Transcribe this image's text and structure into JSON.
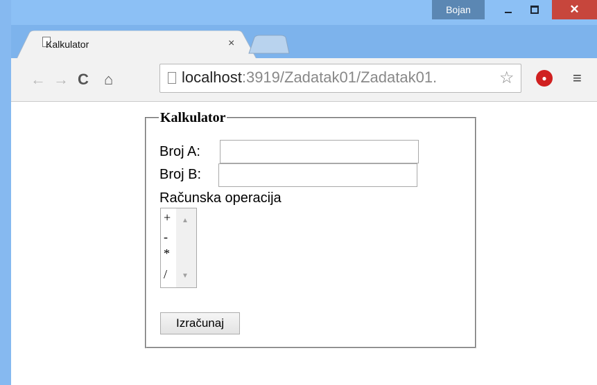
{
  "window": {
    "user": "Bojan",
    "minimize_glyph": "–",
    "maximize_glyph": "□",
    "close_glyph": "✕"
  },
  "tab": {
    "title": "Kalkulator",
    "close_glyph": "×"
  },
  "toolbar": {
    "back_glyph": "←",
    "forward_glyph": "→",
    "reload_glyph": "C",
    "home_glyph": "⌂",
    "url_host": "localhost",
    "url_path": ":3919/Zadatak01/Zadatak01.",
    "star_glyph": "☆",
    "menu_glyph": "≡"
  },
  "form": {
    "legend": "Kalkulator",
    "label_a": "Broj A:",
    "label_b": "Broj B:",
    "label_op": "Računska operacija",
    "value_a": "",
    "value_b": "",
    "operations": [
      "+",
      "-",
      "*",
      "/"
    ],
    "submit_label": "Izračunaj"
  },
  "colors": {
    "titlebar": "#8cc0f5",
    "close_button": "#c7463c",
    "user_badge": "#5b87b3"
  },
  "icons": [
    "page-icon",
    "back-arrow-icon",
    "forward-arrow-icon",
    "reload-icon",
    "home-icon",
    "star-icon",
    "stop-extension-icon",
    "menu-icon"
  ]
}
